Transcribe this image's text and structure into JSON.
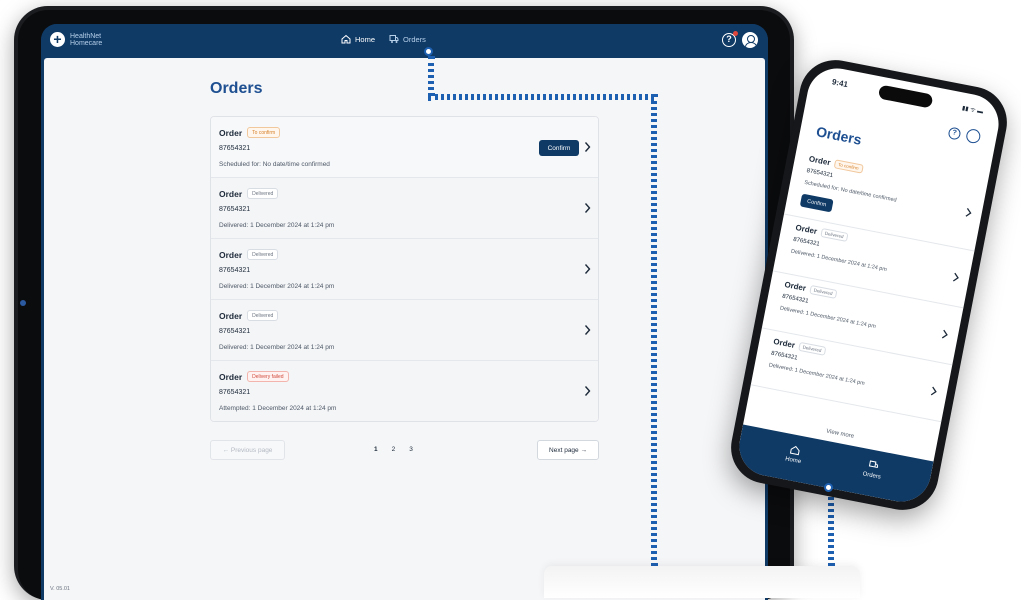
{
  "tablet": {
    "logo": {
      "line1": "HealthNet",
      "line2": "Homecare"
    },
    "nav": [
      {
        "label": "Home",
        "icon": "home-icon",
        "active": false
      },
      {
        "label": "Orders",
        "icon": "truck-icon",
        "active": true
      }
    ],
    "page_title": "Orders",
    "orders": [
      {
        "title": "Order",
        "badge": "To confirm",
        "number": "87654321",
        "detail": "Scheduled for: No date/time confirmed",
        "action": "Confirm"
      },
      {
        "title": "Order",
        "badge": "Delivered",
        "number": "87654321",
        "detail": "Delivered: 1 December 2024 at 1:24 pm"
      },
      {
        "title": "Order",
        "badge": "Delivered",
        "number": "87654321",
        "detail": "Delivered: 1 December 2024 at 1:24 pm"
      },
      {
        "title": "Order",
        "badge": "Delivered",
        "number": "87654321",
        "detail": "Delivered: 1 December 2024 at 1:24 pm"
      },
      {
        "title": "Order",
        "badge": "Delivery failed",
        "number": "87654321",
        "detail": "Attempted: 1 December 2024 at 1:24 pm"
      }
    ],
    "pagination": {
      "prev": "← Previous page",
      "pages": [
        "1",
        "2",
        "3"
      ],
      "current": "1",
      "next": "Next page →"
    },
    "version": "V. 05.01"
  },
  "phone": {
    "time": "9:41",
    "status": "▮▮ ᯤ ▬",
    "page_title": "Orders",
    "orders": [
      {
        "title": "Order",
        "badge": "To confirm",
        "number": "87654321",
        "detail": "Scheduled for: No date/time confirmed",
        "action": "Confirm"
      },
      {
        "title": "Order",
        "badge": "Delivered",
        "number": "87654321",
        "detail": "Delivered: 1 December 2024 at 1:24 pm"
      },
      {
        "title": "Order",
        "badge": "Delivered",
        "number": "87654321",
        "detail": "Delivered: 1 December 2024 at 1:24 pm"
      },
      {
        "title": "Order",
        "badge": "Delivered",
        "number": "87654321",
        "detail": "Delivered: 1 December 2024 at 1:24 pm"
      }
    ],
    "view_more": "View more",
    "tabs": [
      {
        "label": "Home",
        "icon": "home-icon"
      },
      {
        "label": "Orders",
        "icon": "truck-icon"
      }
    ]
  },
  "colors": {
    "navy": "#0f3a66",
    "title_blue": "#1d4f91",
    "connector": "#1d5fb0",
    "warn": "#d6802a",
    "error": "#d04a3c"
  }
}
